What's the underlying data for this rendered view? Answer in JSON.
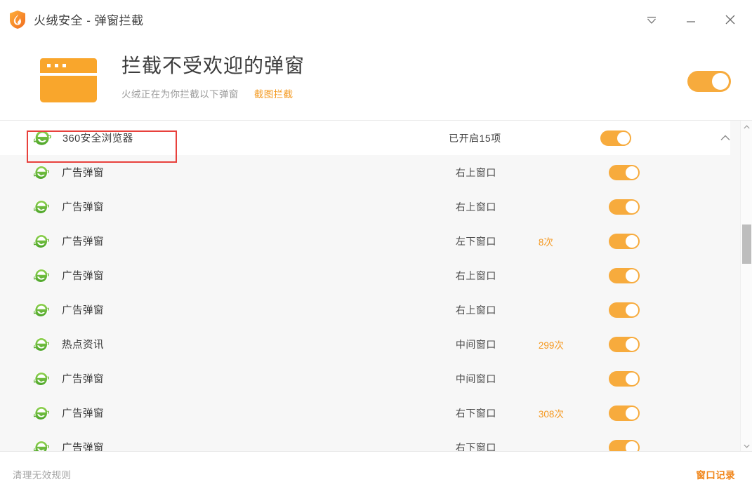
{
  "window": {
    "title": "火绒安全 - 弹窗拦截",
    "logo_icon": "huorong-shield-flame-icon",
    "controls": [
      {
        "name": "menu-icon",
        "label": "▽"
      },
      {
        "name": "minimize-icon",
        "label": "—"
      },
      {
        "name": "close-icon",
        "label": "✕"
      }
    ]
  },
  "header": {
    "icon": "browser-window-icon",
    "title": "拦截不受欢迎的弹窗",
    "subtitle": "火绒正在为你拦截以下弹窗",
    "link": "截图拦截",
    "master_switch_on": true
  },
  "list": {
    "group": {
      "icon": "green-ie-browser-icon",
      "name": "360安全浏览器",
      "status": "已开启15项",
      "switch_on": true,
      "collapse_icon": "chevron-up-icon",
      "highlighted": true
    },
    "rows": [
      {
        "icon": "green-ie-browser-icon",
        "name": "广告弹窗",
        "position": "右上窗口",
        "count": "",
        "switch_on": true
      },
      {
        "icon": "green-ie-browser-icon",
        "name": "广告弹窗",
        "position": "右上窗口",
        "count": "",
        "switch_on": true
      },
      {
        "icon": "green-ie-browser-icon",
        "name": "广告弹窗",
        "position": "左下窗口",
        "count": "8次",
        "switch_on": true
      },
      {
        "icon": "green-ie-browser-icon",
        "name": "广告弹窗",
        "position": "右上窗口",
        "count": "",
        "switch_on": true
      },
      {
        "icon": "green-ie-browser-icon",
        "name": "广告弹窗",
        "position": "右上窗口",
        "count": "",
        "switch_on": true
      },
      {
        "icon": "green-ie-browser-icon",
        "name": "热点资讯",
        "position": "中间窗口",
        "count": "299次",
        "switch_on": true
      },
      {
        "icon": "green-ie-browser-icon",
        "name": "广告弹窗",
        "position": "中间窗口",
        "count": "",
        "switch_on": true
      },
      {
        "icon": "green-ie-browser-icon",
        "name": "广告弹窗",
        "position": "右下窗口",
        "count": "308次",
        "switch_on": true
      },
      {
        "icon": "green-ie-browser-icon",
        "name": "广告弹窗",
        "position": "右下窗口",
        "count": "",
        "switch_on": true
      }
    ]
  },
  "scrollbar": {
    "up_icon": "scroll-up-arrow-icon",
    "down_icon": "scroll-down-arrow-icon"
  },
  "footer": {
    "clean_rules": "清理无效规则",
    "window_records": "窗口记录"
  },
  "colors": {
    "accent_orange": "#f7ab3d",
    "link_orange": "#f49a21",
    "count_orange": "#f59a23",
    "record_orange": "#f08519",
    "annotation_red": "#e8413c",
    "row_bg": "#f7f7f7",
    "group_bg": "#ffffff",
    "text_dark": "#3b3b3b",
    "text_muted": "#9b9b9b"
  }
}
